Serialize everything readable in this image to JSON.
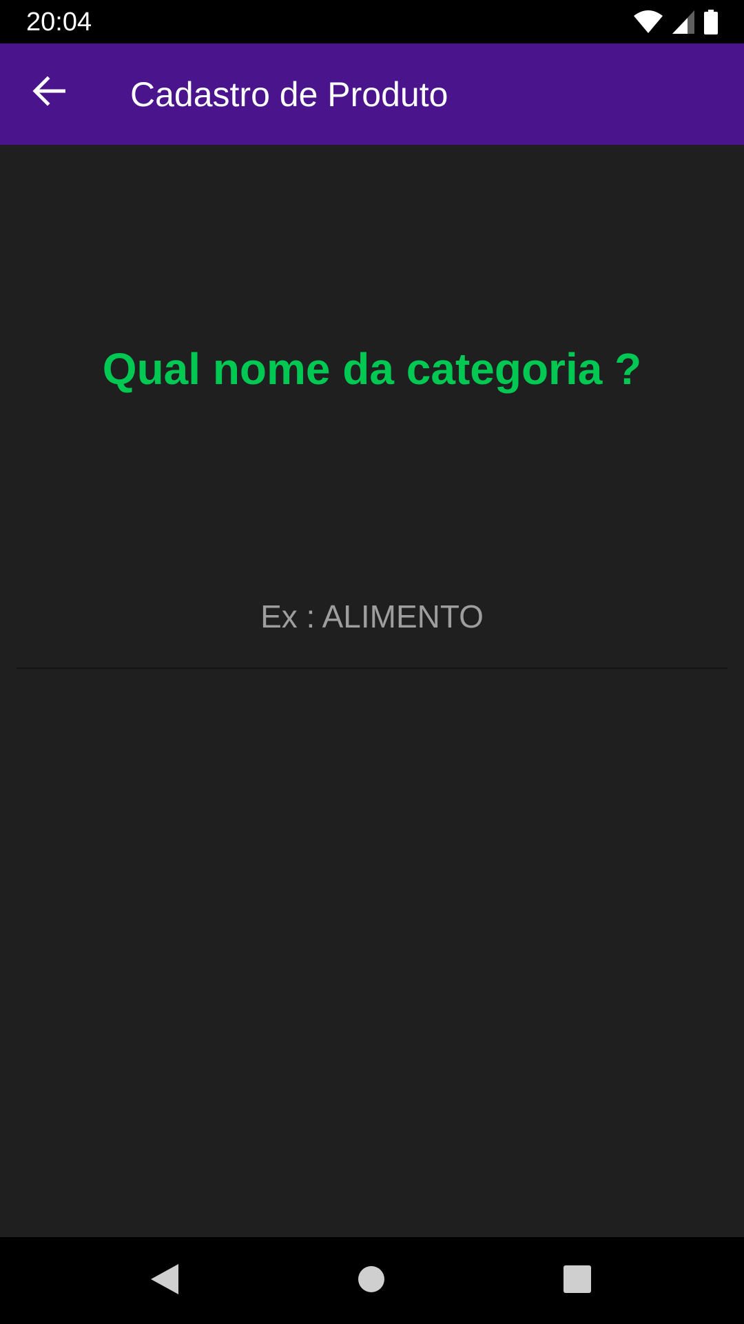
{
  "status_bar": {
    "time": "20:04",
    "icons": [
      "wifi-icon",
      "cell-signal-icon",
      "battery-icon"
    ]
  },
  "app_bar": {
    "title": "Cadastro de Produto",
    "back_icon": "arrow-back-icon",
    "background_color": "#4a148c"
  },
  "form": {
    "question": "Qual nome da categoria ?",
    "question_color": "#00c853",
    "category_input": {
      "value": "",
      "placeholder": "Ex : ALIMENTO"
    }
  },
  "nav_bar": {
    "buttons": [
      "nav-back-icon",
      "nav-home-icon",
      "nav-recents-icon"
    ]
  }
}
